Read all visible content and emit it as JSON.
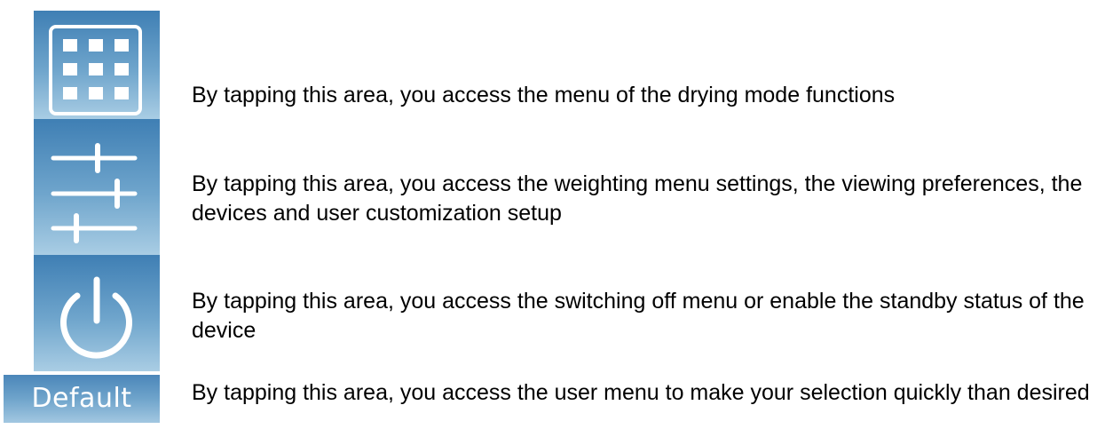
{
  "menu": {
    "modes_button": {
      "icon": "grid-icon",
      "description": "By tapping this area, you access the menu of the drying mode functions"
    },
    "settings_button": {
      "icon": "sliders-icon",
      "description": "By tapping this area, you access the weighting menu settings, the viewing preferences, the devices and user customization setup"
    },
    "power_button": {
      "icon": "power-icon",
      "description": "By tapping this area, you access the switching off menu or enable the standby status of the device"
    },
    "user_button": {
      "label": "Default",
      "description": "By tapping this area, you access the user menu to make your selection quickly than desired"
    }
  },
  "colors": {
    "button_top": "#3f7fb4",
    "button_bottom": "#a9cde4",
    "icon": "#ffffff"
  }
}
